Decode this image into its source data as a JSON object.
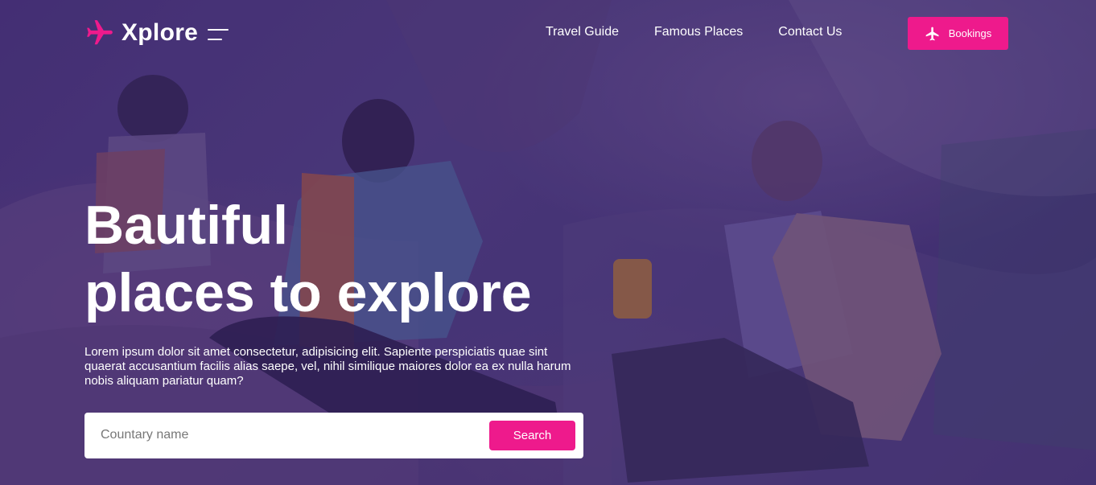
{
  "brand": {
    "name": "Xplore",
    "accent_color": "#ee1a8c",
    "logo_icon": "airplane-icon",
    "menu_icon": "hamburger-icon"
  },
  "nav": {
    "items": [
      {
        "label": "Travel Guide"
      },
      {
        "label": "Famous Places"
      },
      {
        "label": "Contact Us"
      }
    ]
  },
  "bookings_button": {
    "label": "Bookings",
    "icon": "airplane-icon"
  },
  "hero": {
    "headline_line1": "Bautiful",
    "headline_line2": "places to explore",
    "description": "Lorem ipsum dolor sit amet consectetur, adipisicing elit. Sapiente perspiciatis quae sint quaerat accusantium facilis alias saepe, vel, nihil similique maiores dolor ea ex nulla harum nobis aliquam pariatur quam?"
  },
  "search": {
    "placeholder": "Countary name",
    "value": "",
    "button_label": "Search"
  }
}
